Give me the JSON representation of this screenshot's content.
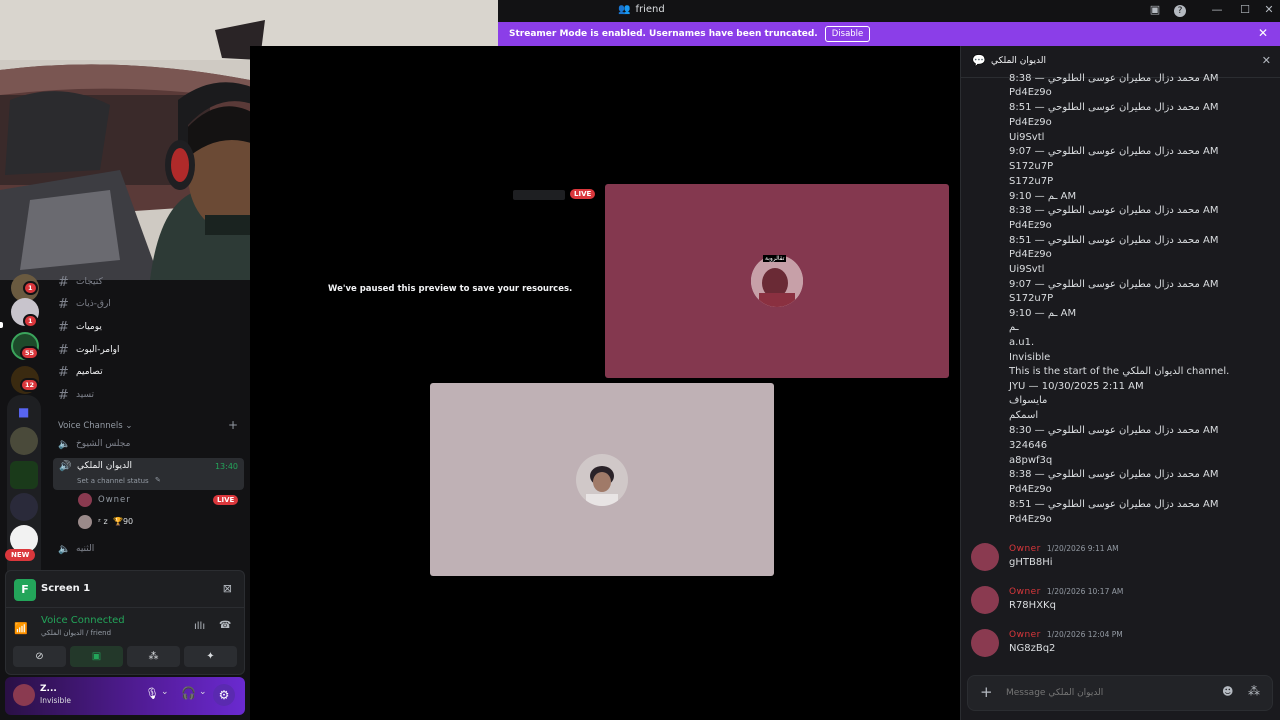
{
  "window": {
    "title": "friend",
    "icon": "friends-icon"
  },
  "banner": {
    "text": "Streamer Mode is enabled. Usernames have been truncated.",
    "button": "Disable"
  },
  "guilds": {
    "badges": [
      "1",
      "1",
      "55",
      "12"
    ],
    "new_label": "NEW"
  },
  "channels": {
    "text": [
      "كتيجات",
      "ارق-ذيات",
      "يوميات",
      "اوامر-البوت",
      "تصاميم",
      "تسيد"
    ],
    "voice_header": "Voice Channels",
    "voice": [
      {
        "name": "مجلس الشيوخ"
      },
      {
        "name": "الديوان الملكي",
        "timer": "13:40",
        "status": "Set a channel status"
      },
      {
        "name": "الثنيه"
      }
    ],
    "members": [
      {
        "name": "Owner",
        "badge": "LIVE"
      },
      {
        "name": "ᶻ z",
        "trophy": "90"
      }
    ]
  },
  "voice_panel": {
    "screen_title": "Screen 1",
    "connected": "Voice Connected",
    "location": "الديوان الملكي / friend"
  },
  "user": {
    "name": "Z...",
    "status": "Invisible"
  },
  "stage": {
    "live_label": "LIVE",
    "paused_message": "We've paused this preview to save your resources.",
    "tile_avatar_label": "تقالروبة",
    "colors": {
      "tile1": "#84384f",
      "tile2": "#bfb1b5"
    }
  },
  "chat": {
    "channel": "الديوان الملكي",
    "log": [
      "8:38 — محمد دزال مطيران عوسى الطلوحي AM",
      "Pd4Ez9o",
      "8:51 — محمد دزال مطيران عوسى الطلوحي AM",
      "Pd4Ez9o",
      "Ui9Svtl",
      "9:07 — محمد دزال مطيران عوسى الطلوحي AM",
      "S172u7P",
      "S172u7P",
      "ـم — 9:10 AM",
      "8:38 — محمد دزال مطيران عوسى الطلوحي AM",
      "Pd4Ez9o",
      "8:51 — محمد دزال مطيران عوسى الطلوحي AM",
      "Pd4Ez9o",
      "Ui9Svtl",
      "9:07 — محمد دزال مطيران عوسى الطلوحي AM",
      "S172u7P",
      "ـم — 9:10 AM",
      "ـم",
      "a.u1.",
      "Invisible",
      "This is the start of the الديوان الملكي channel.",
      "JYU — 10/30/2025 2:11 AM",
      "مايسواف",
      "اسمكم",
      "8:30 — محمد دزال مطيران عوسى الطلوحي AM",
      "324646",
      "a8pwf3q",
      "8:38 — محمد دزال مطيران عوسى الطلوحي AM",
      "Pd4Ez9o",
      "8:51 — محمد دزال مطيران عوسى الطلوحي AM",
      "Pd4Ez9o"
    ],
    "messages": [
      {
        "author": "Owner",
        "time": "1/20/2026 9:11 AM",
        "text": "gHTB8Hi"
      },
      {
        "author": "Owner",
        "time": "1/20/2026 10:17 AM",
        "text": "R78HXKq"
      },
      {
        "author": "Owner",
        "time": "1/20/2026 12:04 PM",
        "text": "NG8zBq2"
      }
    ],
    "placeholder": "Message الديوان الملكي"
  }
}
